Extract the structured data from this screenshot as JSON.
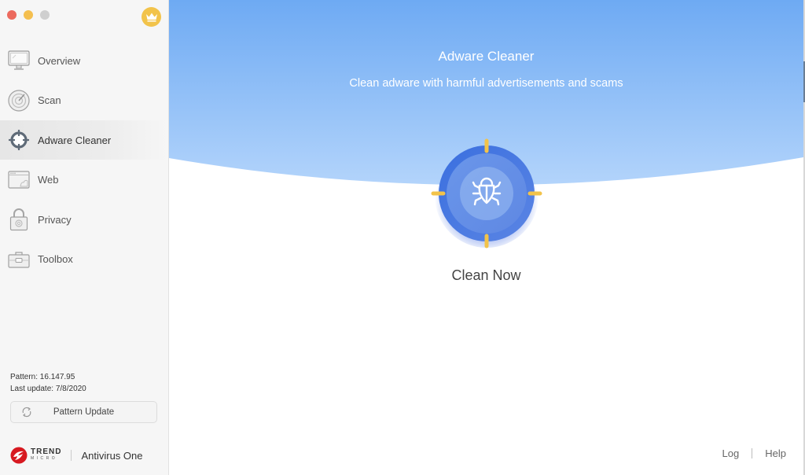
{
  "window": {
    "controls": [
      "close",
      "minimize",
      "zoom"
    ],
    "premium_icon": "crown-icon"
  },
  "sidebar": {
    "items": [
      {
        "label": "Overview",
        "icon": "monitor-icon",
        "active": false
      },
      {
        "label": "Scan",
        "icon": "radar-icon",
        "active": false
      },
      {
        "label": "Adware Cleaner",
        "icon": "crosshair-icon",
        "active": true
      },
      {
        "label": "Web",
        "icon": "browser-window-icon",
        "active": false
      },
      {
        "label": "Privacy",
        "icon": "padlock-icon",
        "active": false
      },
      {
        "label": "Toolbox",
        "icon": "toolbox-icon",
        "active": false
      }
    ],
    "pattern": "Pattern: 16.147.95",
    "last_update": "Last update: 7/8/2020",
    "pattern_update_label": "Pattern Update",
    "brand": {
      "company_line1": "TREND",
      "company_line2": "MICRO",
      "product": "Antivirus One"
    }
  },
  "main": {
    "title": "Adware Cleaner",
    "subtitle": "Clean adware with harmful advertisements and scams",
    "action_label": "Clean Now",
    "action_icon": "bug-icon",
    "footer": {
      "log_label": "Log",
      "help_label": "Help"
    }
  },
  "colors": {
    "hero_top": "#6eaaf3",
    "hero_bottom": "#b0d2fb",
    "ring_outer": "#3f73de",
    "ring_inner": "#7ea7ec",
    "crosshair_marks": "#f2c34a",
    "brand_red": "#d71920"
  }
}
